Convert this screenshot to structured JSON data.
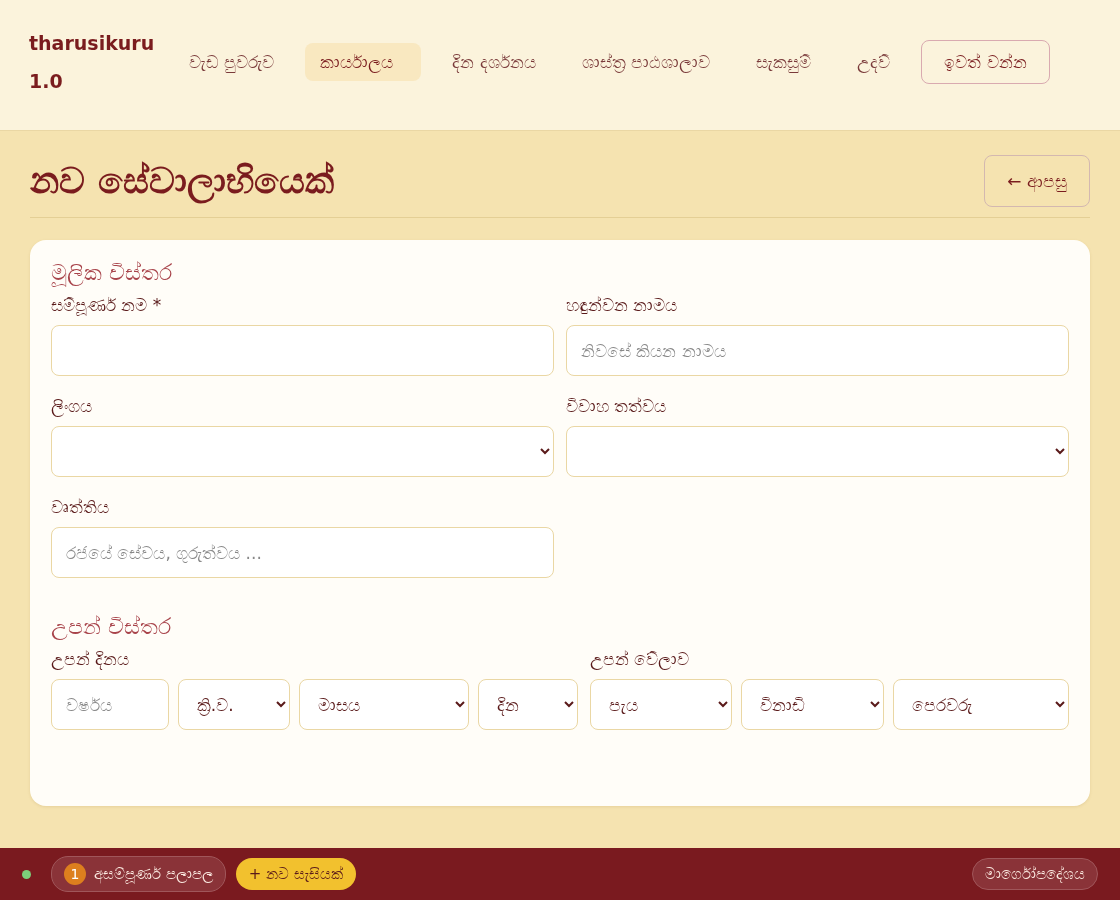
{
  "brand": {
    "name": "tharusikuru",
    "version": "1.0"
  },
  "nav": [
    {
      "label": "වැඩ පුවරුව",
      "selected": false
    },
    {
      "label": "කාර්යාලය",
      "selected": true
    },
    {
      "label": "දින දර්ශනය",
      "selected": false
    },
    {
      "label": "ශාස්ත්‍ර පාඨශාලාව",
      "selected": false
    },
    {
      "label": "සැකසුම්",
      "selected": false
    },
    {
      "label": "උදව්",
      "selected": false
    }
  ],
  "logout_button": "ඉවත් වන්න",
  "page": {
    "title": "නව සේවාලාභියෙක්",
    "back_button": "← ආපසු"
  },
  "sections": [
    {
      "title": "මූලික විස්තර",
      "fields": [
        {
          "label": "සම්පූර්ණ නම *",
          "parts": [
            {
              "kind": "input"
            }
          ]
        },
        {
          "label": "හඳුන්වන නාමය",
          "parts": [
            {
              "kind": "input",
              "placeholder": "නිවසේ කියන නාමය"
            }
          ]
        },
        {
          "label": "ලිංගය",
          "parts": [
            {
              "kind": "select"
            }
          ]
        },
        {
          "label": "විවාහ තත්වය",
          "parts": [
            {
              "kind": "select"
            }
          ]
        },
        {
          "label": "වෘත්තිය",
          "parts": [
            {
              "kind": "input",
              "placeholder": "රජයේ සේවය, ගුරුත්වය ..."
            }
          ]
        }
      ]
    },
    {
      "title": "උපන් විස්තර",
      "fields": [
        {
          "label": "උපන් දිනය",
          "parts": [
            {
              "kind": "input",
              "placeholder": "වර්ෂය"
            },
            {
              "kind": "select",
              "value": "ක්‍රි.ව."
            },
            {
              "kind": "select",
              "value": "මාසය"
            },
            {
              "kind": "select",
              "value": "දින"
            }
          ]
        },
        {
          "label": "උපන් වේලාව",
          "parts": [
            {
              "kind": "select",
              "value": "පැය"
            },
            {
              "kind": "select",
              "value": "විනාඩි"
            },
            {
              "kind": "select",
              "value": "පෙරවරු"
            }
          ]
        }
      ]
    }
  ],
  "footer": {
    "incomplete_count": "1",
    "incomplete_label": "අසම්පූර්ණ පලාපල",
    "new_session_button": "+ නව සැසියක්",
    "guide_button": "මාර්ගෝපදේශය"
  }
}
